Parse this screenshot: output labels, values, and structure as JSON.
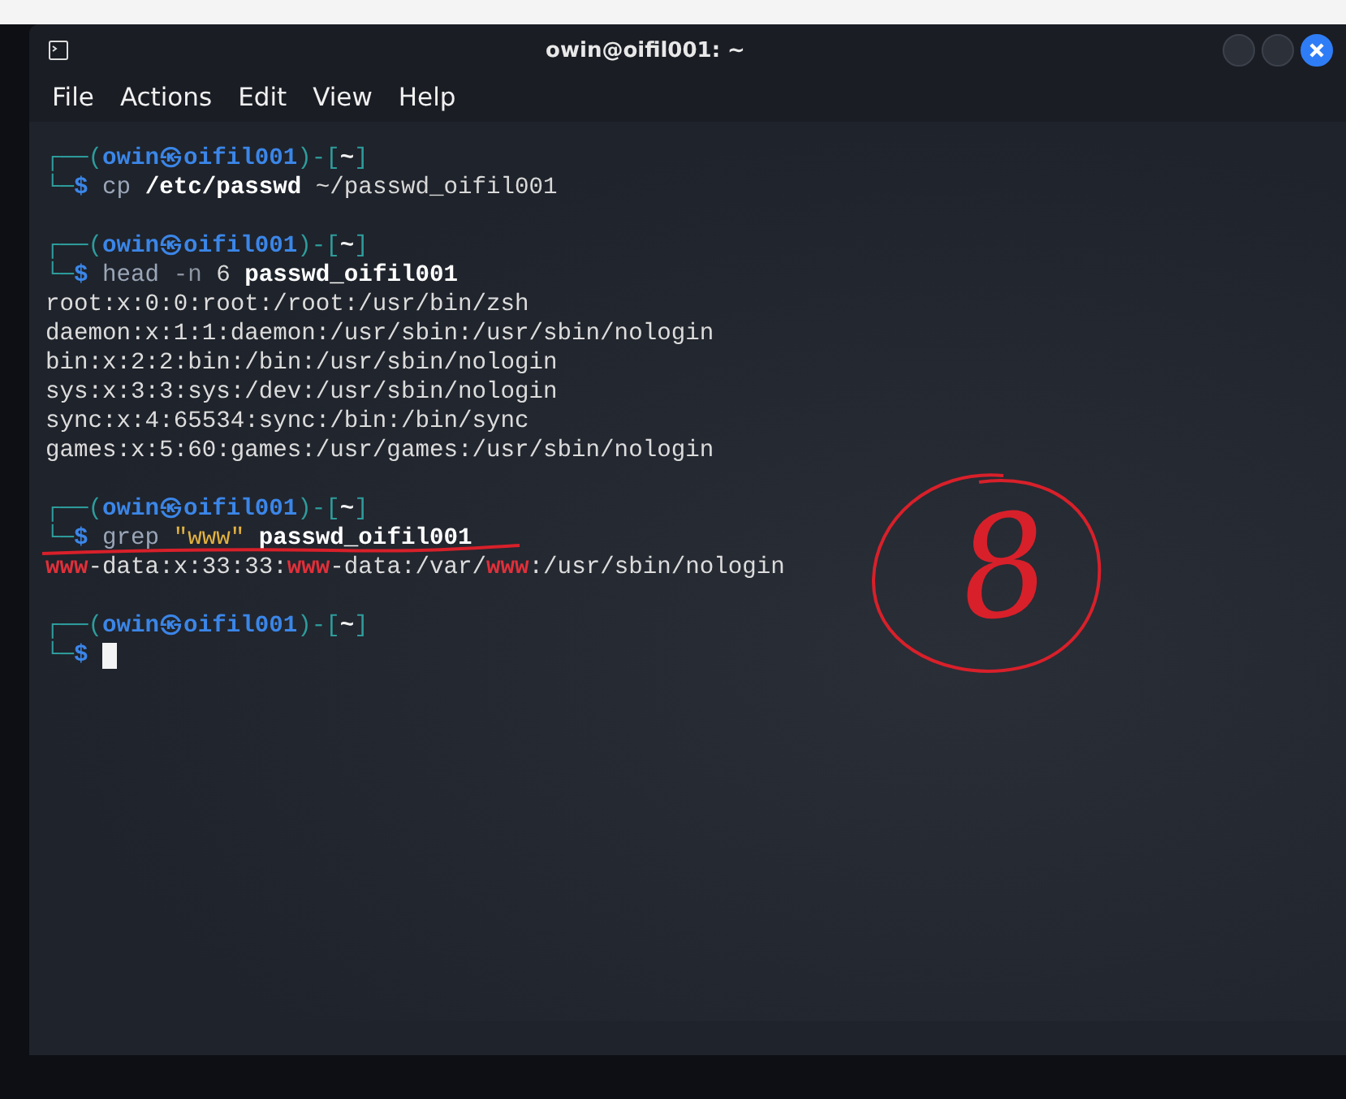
{
  "window": {
    "title": "owin@oifil001: ~"
  },
  "menu": [
    "File",
    "Actions",
    "Edit",
    "View",
    "Help"
  ],
  "blocks": [
    {
      "prompt": [
        {
          "text": "┌──(",
          "kind": "frame"
        },
        {
          "text": "owin㉿oifil001",
          "kind": "user"
        },
        {
          "text": ")-[",
          "kind": "frame"
        },
        {
          "text": "~",
          "kind": "dir"
        },
        {
          "text": "]",
          "kind": "frame"
        }
      ],
      "command": [
        {
          "text": "└─",
          "kind": "frame"
        },
        {
          "text": "$ ",
          "kind": "dollar"
        },
        {
          "text": "cp ",
          "kind": "command"
        },
        {
          "text": "/etc/passwd",
          "kind": "bold"
        },
        {
          "text": " ~/passwd_oifil001",
          "kind": "plain"
        }
      ],
      "underlined": false,
      "cursor": false
    },
    {
      "prompt": [
        {
          "text": "┌──(",
          "kind": "frame"
        },
        {
          "text": "owin㉿oifil001",
          "kind": "user"
        },
        {
          "text": ")-[",
          "kind": "frame"
        },
        {
          "text": "~",
          "kind": "dir"
        },
        {
          "text": "]",
          "kind": "frame"
        }
      ],
      "command": [
        {
          "text": "└─",
          "kind": "frame"
        },
        {
          "text": "$ ",
          "kind": "dollar"
        },
        {
          "text": "head ",
          "kind": "command"
        },
        {
          "text": "-n ",
          "kind": "option"
        },
        {
          "text": "6 ",
          "kind": "plain"
        },
        {
          "text": "passwd_oifil001",
          "kind": "bold"
        }
      ],
      "underlined": false,
      "cursor": false,
      "output": [
        [
          {
            "text": "root:x:0:0:root:/root:/usr/bin/zsh",
            "kind": "out"
          }
        ],
        [
          {
            "text": "daemon:x:1:1:daemon:/usr/sbin:/usr/sbin/nologin",
            "kind": "out"
          }
        ],
        [
          {
            "text": "bin:x:2:2:bin:/bin:/usr/sbin/nologin",
            "kind": "out"
          }
        ],
        [
          {
            "text": "sys:x:3:3:sys:/dev:/usr/sbin/nologin",
            "kind": "out"
          }
        ],
        [
          {
            "text": "sync:x:4:65534:sync:/bin:/bin/sync",
            "kind": "out"
          }
        ],
        [
          {
            "text": "games:x:5:60:games:/usr/games:/usr/sbin/nologin",
            "kind": "out"
          }
        ]
      ]
    },
    {
      "prompt": [
        {
          "text": "┌──(",
          "kind": "frame"
        },
        {
          "text": "owin㉿oifil001",
          "kind": "user"
        },
        {
          "text": ")-[",
          "kind": "frame"
        },
        {
          "text": "~",
          "kind": "dir"
        },
        {
          "text": "]",
          "kind": "frame"
        }
      ],
      "command": [
        {
          "text": "└─",
          "kind": "frame"
        },
        {
          "text": "$ ",
          "kind": "dollar"
        },
        {
          "text": "grep ",
          "kind": "command"
        },
        {
          "text": "\"www\" ",
          "kind": "string"
        },
        {
          "text": "passwd_oifil001",
          "kind": "bold"
        }
      ],
      "underlined": true,
      "cursor": false,
      "output": [
        [
          {
            "text": "www",
            "kind": "match"
          },
          {
            "text": "-data:x:33:33:",
            "kind": "out"
          },
          {
            "text": "www",
            "kind": "match"
          },
          {
            "text": "-data:/var/",
            "kind": "out"
          },
          {
            "text": "www",
            "kind": "match"
          },
          {
            "text": ":/usr/sbin/nologin",
            "kind": "out"
          }
        ]
      ]
    },
    {
      "prompt": [
        {
          "text": "┌──(",
          "kind": "frame"
        },
        {
          "text": "owin㉿oifil001",
          "kind": "user"
        },
        {
          "text": ")-[",
          "kind": "frame"
        },
        {
          "text": "~",
          "kind": "dir"
        },
        {
          "text": "]",
          "kind": "frame"
        }
      ],
      "command": [
        {
          "text": "└─",
          "kind": "frame"
        },
        {
          "text": "$ ",
          "kind": "dollar"
        }
      ],
      "underlined": false,
      "cursor": true
    }
  ],
  "annotation": {
    "text": "8"
  }
}
